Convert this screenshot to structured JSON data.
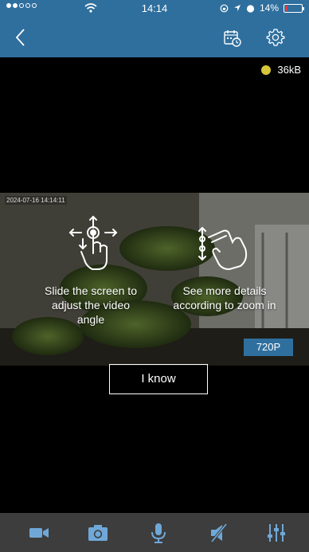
{
  "status_bar": {
    "time": "14:14",
    "battery_text": "14%",
    "battery_level": 0.14,
    "signal_icon": "signal-dots-icon",
    "wifi_icon": "wifi-icon",
    "location_icon": "location-arrow-icon",
    "alarm_icon": "alarm-icon",
    "lock_icon": "rotation-lock-icon"
  },
  "nav": {
    "back_icon": "chevron-left-icon",
    "calendar_icon": "calendar-playback-icon",
    "settings_icon": "gear-icon",
    "bar_color": "#2f6f9e"
  },
  "stream": {
    "bitrate": "36kB",
    "indicator_color": "#d8c63a",
    "camera_stamp": "2024-07-16 14:14:11",
    "quality": "720P"
  },
  "hints": {
    "left_text": "Slide the screen to adjust the video angle",
    "right_text": "See more details according to zoom in",
    "left_icon": "hand-drag-arrows-icon",
    "right_icon": "hand-pinch-zoom-icon",
    "confirm_label": "I know"
  },
  "toolbar": {
    "items": [
      {
        "icon": "video-record-icon"
      },
      {
        "icon": "camera-snapshot-icon"
      },
      {
        "icon": "microphone-icon"
      },
      {
        "icon": "speaker-muted-icon"
      },
      {
        "icon": "equalizer-sliders-icon"
      }
    ],
    "background": "#3d3d3d",
    "icon_color": "#6fa8d8"
  }
}
